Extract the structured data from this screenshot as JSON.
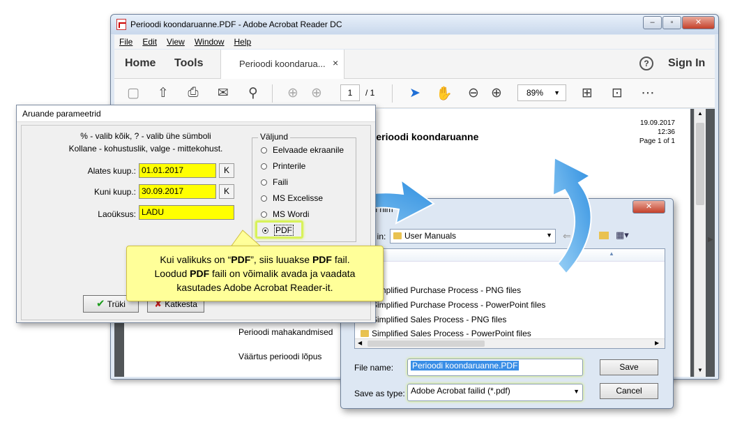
{
  "acrobat": {
    "title": "Perioodi koondaruanne.PDF - Adobe Acrobat Reader DC",
    "menu": [
      "File",
      "Edit",
      "View",
      "Window",
      "Help"
    ],
    "tabs": {
      "home": "Home",
      "tools": "Tools",
      "doc": "Perioodi koondarua...",
      "doc_close": "×",
      "sign_in": "Sign In",
      "help": "?"
    },
    "toolbar": {
      "page_current": "1",
      "page_total": "/ 1",
      "zoom": "89%"
    },
    "page": {
      "heading": "Perioodi koondaruanne",
      "date": "19.09.2017",
      "time": "12:36",
      "pageinfo": "Page 1 of 1",
      "row1": "Perioodi mahakandmised",
      "row2": "Väärtus perioodi lõpus"
    }
  },
  "params": {
    "title": "Aruande parameetrid",
    "hint1": "% - valib kõik, ? - valib ühe sümboli",
    "hint2": "Kollane - kohustuslik, valge - mittekohust.",
    "from_label": "Alates kuup.:",
    "from_value": "01.01.2017",
    "to_label": "Kuni kuup.:",
    "to_value": "30.09.2017",
    "k": "K",
    "unit_label": "Laoüksus:",
    "unit_value": "LADU",
    "output_group": "Väljund",
    "options": [
      "Eelvaade ekraanile",
      "Printerile",
      "Faili",
      "MS Excelisse",
      "MS Wordi",
      "PDF"
    ],
    "selected": "PDF",
    "print_btn": "Trüki",
    "cancel_btn": "Katkesta"
  },
  "callout": {
    "l1a": "Kui valikuks on “",
    "l1b": "PDF",
    "l1c": "”, siis luuakse ",
    "l1d": "PDF",
    "l1e": " fail.",
    "l2a": "Loodud ",
    "l2b": "PDF",
    "l2c": " faili on võimalik avada ja vaadata",
    "l3": "kasutades Adobe Acrobat Reader-it."
  },
  "save": {
    "title": "Faili nim",
    "save_in_label": "Save in:",
    "save_in_value": "User Manuals",
    "items": [
      "icy",
      "Simplified Purchase Process - PNG files",
      "Simplified Purchase Process - PowerPoint files",
      "Simplified Sales Process - PNG files",
      "Simplified Sales Process - PowerPoint files"
    ],
    "filename_label": "File name:",
    "filename_value": "Perioodi koondaruanne.PDF",
    "type_label": "Save as type:",
    "type_value": "Adobe Acrobat failid (*.pdf)",
    "save_btn": "Save",
    "cancel_btn": "Cancel"
  },
  "colors": {
    "required": "#ffff00",
    "arrow": "#3fa0e6",
    "highlight": "#d8f25a"
  }
}
